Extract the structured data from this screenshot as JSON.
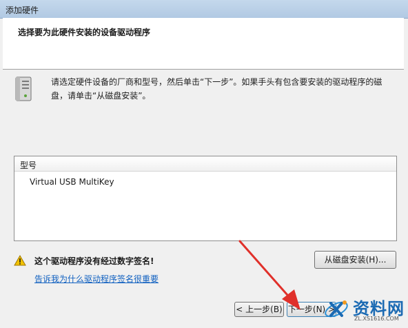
{
  "window": {
    "title": "添加硬件"
  },
  "header": {
    "title": "选择要为此硬件安装的设备驱动程序"
  },
  "content": {
    "instruction": "请选定硬件设备的厂商和型号，然后单击“下一步”。如果手头有包含要安装的驱动程序的磁盘，请单击“从磁盘安装”。",
    "list": {
      "column_header": "型号",
      "items": [
        "Virtual USB MultiKey"
      ]
    },
    "warning": {
      "text": "这个驱动程序没有经过数字签名!",
      "link": "告诉我为什么驱动程序签名很重要"
    },
    "have_disk_button": "从磁盘安装(H)..."
  },
  "footer": {
    "back_button": "< 上一步(B)",
    "next_button": "下一步(N) >"
  },
  "watermark": {
    "name": "资料网",
    "url": "ZL.XS1616.COM"
  },
  "colors": {
    "arrow": "#e0302a",
    "link": "#1060c0",
    "warning": "#f2c200"
  }
}
